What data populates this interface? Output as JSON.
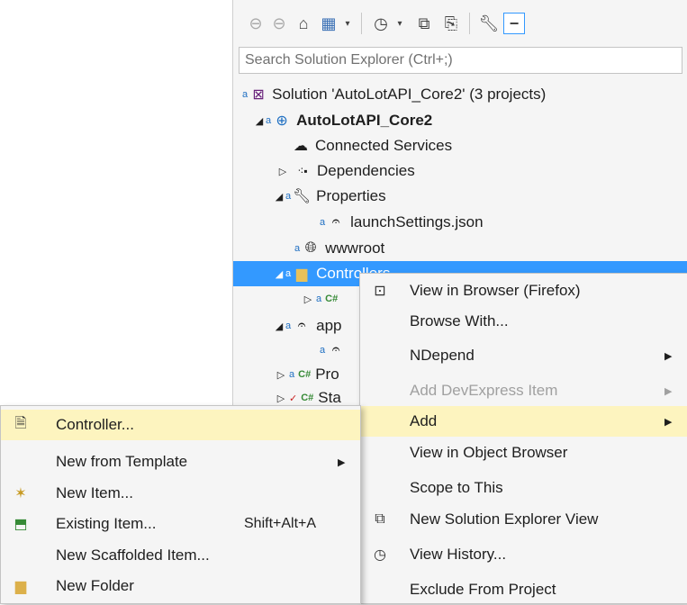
{
  "search": {
    "placeholder": "Search Solution Explorer (Ctrl+;)"
  },
  "toolbar": {
    "icons": [
      "back-icon",
      "forward-icon",
      "home-icon",
      "switch-views-icon",
      "dropdown-arrow",
      "history-icon",
      "dropdown-arrow",
      "collapse-all-icon",
      "show-all-files-icon",
      "properties-wrench-icon",
      "preview-icon"
    ]
  },
  "tree": {
    "solution": "Solution 'AutoLotAPI_Core2' (3 projects)",
    "project": "AutoLotAPI_Core2",
    "connected": "Connected Services",
    "dependencies": "Dependencies",
    "properties": "Properties",
    "launch": "launchSettings.json",
    "wwwroot": "wwwroot",
    "controllers": "Controllers",
    "cs_badge": "C#",
    "app": "app",
    "pro": "Pro",
    "sta": "Sta"
  },
  "menu": {
    "view_browser": "View in Browser (Firefox)",
    "browse_with": "Browse With...",
    "ndepend": "NDepend",
    "add_devexpress": "Add DevExpress Item",
    "add": "Add",
    "view_object": "View in Object Browser",
    "scope": "Scope to This",
    "new_se_view": "New Solution Explorer View",
    "view_history": "View History...",
    "exclude": "Exclude From Project"
  },
  "submenu": {
    "controller": "Controller...",
    "new_template": "New from Template",
    "new_item": "New Item...",
    "existing_item": "Existing Item...",
    "existing_shortcut": "Shift+Alt+A",
    "scaffolded": "New Scaffolded Item...",
    "new_folder": "New Folder"
  },
  "colors": {
    "selection": "#3399ff",
    "highlight": "#fdf4bf",
    "csharp": "#368a36"
  }
}
